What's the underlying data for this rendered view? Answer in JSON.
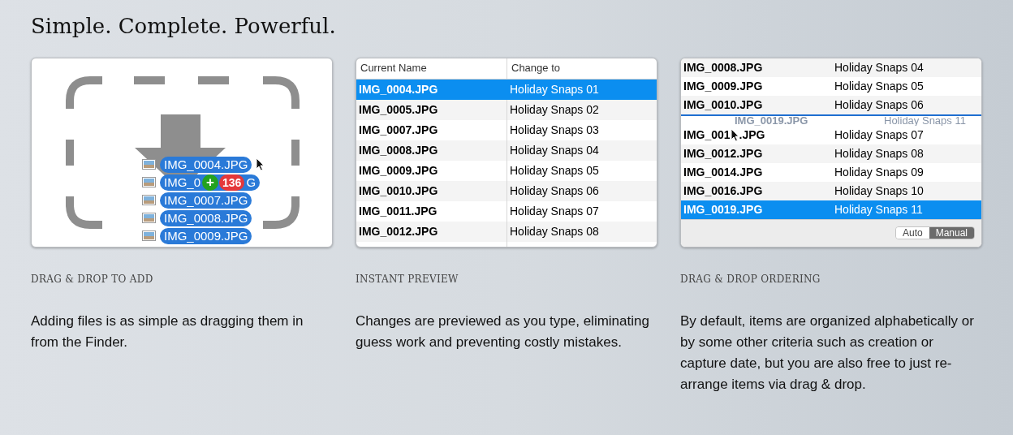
{
  "title": "Simple. Complete. Powerful.",
  "features": [
    {
      "kind": "drop",
      "caption": "DRAG & DROP TO ADD",
      "text": "Adding files is as simple as dragging them in from the Finder.",
      "chips": [
        {
          "text": "IMG_0004.JPG"
        },
        {
          "text": "IMG_0",
          "text_end": "G",
          "count": "136",
          "plus": "+"
        },
        {
          "text": "IMG_0007.JPG"
        },
        {
          "text": "IMG_0008.JPG"
        },
        {
          "text": "IMG_0009.JPG"
        }
      ]
    },
    {
      "kind": "preview",
      "caption": "INSTANT PREVIEW",
      "text": "Changes are previewed as you type, eliminating guess work and preventing costly mistakes.",
      "columns": [
        "Current Name",
        "Change to"
      ],
      "rows": [
        {
          "name": "IMG_0004.JPG",
          "change": "Holiday Snaps 01",
          "selected": true
        },
        {
          "name": "IMG_0005.JPG",
          "change": "Holiday Snaps 02",
          "selected": false
        },
        {
          "name": "IMG_0007.JPG",
          "change": "Holiday Snaps 03",
          "selected": false
        },
        {
          "name": "IMG_0008.JPG",
          "change": "Holiday Snaps 04",
          "selected": false
        },
        {
          "name": "IMG_0009.JPG",
          "change": "Holiday Snaps 05",
          "selected": false
        },
        {
          "name": "IMG_0010.JPG",
          "change": "Holiday Snaps 06",
          "selected": false
        },
        {
          "name": "IMG_0011.JPG",
          "change": "Holiday Snaps 07",
          "selected": false
        },
        {
          "name": "IMG_0012.JPG",
          "change": "Holiday Snaps 08",
          "selected": false
        }
      ]
    },
    {
      "kind": "ordering",
      "caption": "DRAG & DROP ORDERING",
      "text": "By default, items are organized alphabetically or by some other criteria such as creation or capture date, but you are also free to just re-arrange items via drag & drop.",
      "rows": [
        {
          "name": "IMG_0008.JPG",
          "change": "Holiday Snaps 04",
          "selected": false
        },
        {
          "name": "IMG_0009.JPG",
          "change": "Holiday Snaps 05",
          "selected": false
        },
        {
          "name": "IMG_0010.JPG",
          "change": "Holiday Snaps 06",
          "selected": false
        },
        {
          "kind": "ghost",
          "name": "IMG_0019.JPG",
          "change": "Holiday Snaps 11"
        },
        {
          "name": "IMG_001",
          "name_end": ".JPG",
          "change": "Holiday Snaps 07",
          "selected": false
        },
        {
          "name": "IMG_0012.JPG",
          "change": "Holiday Snaps 08",
          "selected": false
        },
        {
          "name": "IMG_0014.JPG",
          "change": "Holiday Snaps 09",
          "selected": false
        },
        {
          "name": "IMG_0016.JPG",
          "change": "Holiday Snaps 10",
          "selected": false
        },
        {
          "name": "IMG_0019.JPG",
          "change": "Holiday Snaps 11",
          "selected": true
        }
      ],
      "segments": [
        {
          "label": "Auto",
          "selected": false
        },
        {
          "label": "Manual",
          "selected": true
        }
      ]
    }
  ]
}
